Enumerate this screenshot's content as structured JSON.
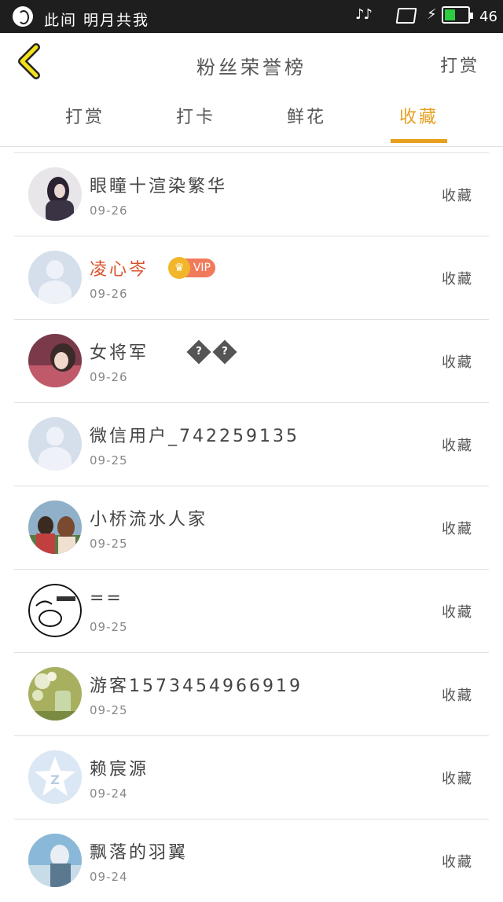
{
  "status_bar": {
    "text": "此间 明月共我",
    "battery_percent": 46,
    "battery_text": "46",
    "music_icon": "♪♪",
    "charge_icon": "⚡"
  },
  "header": {
    "title": "粉丝荣誉榜",
    "reward_label": "打赏",
    "back_icon": "chevron-left-icon",
    "accent_color": "#e8a020"
  },
  "tabs": [
    {
      "label": "打赏",
      "active": false
    },
    {
      "label": "打卡",
      "active": false
    },
    {
      "label": "鲜花",
      "active": false
    },
    {
      "label": "收藏",
      "active": true
    }
  ],
  "rows": [
    {
      "name": "眼瞳十渲染繁华",
      "date": "09-26",
      "action": "收藏",
      "vip": false
    },
    {
      "name": "凌心岑",
      "date": "09-26",
      "action": "收藏",
      "vip": true,
      "vip_label": "VIP",
      "name_color": "#d9532e"
    },
    {
      "name": "女将军",
      "date": "09-26",
      "action": "收藏",
      "vip": false,
      "glyphs": [
        "?",
        "?"
      ]
    },
    {
      "name": "微信用户_742259135",
      "date": "09-25",
      "action": "收藏",
      "vip": false
    },
    {
      "name": "小桥流水人家",
      "date": "09-25",
      "action": "收藏",
      "vip": false
    },
    {
      "name": "==",
      "date": "09-25",
      "action": "收藏",
      "vip": false
    },
    {
      "name": "游客1573454966919",
      "date": "09-25",
      "action": "收藏",
      "vip": false
    },
    {
      "name": "赖宸源",
      "date": "09-24",
      "action": "收藏",
      "vip": false
    },
    {
      "name": "飘落的羽翼",
      "date": "09-24",
      "action": "收藏",
      "vip": false
    }
  ]
}
